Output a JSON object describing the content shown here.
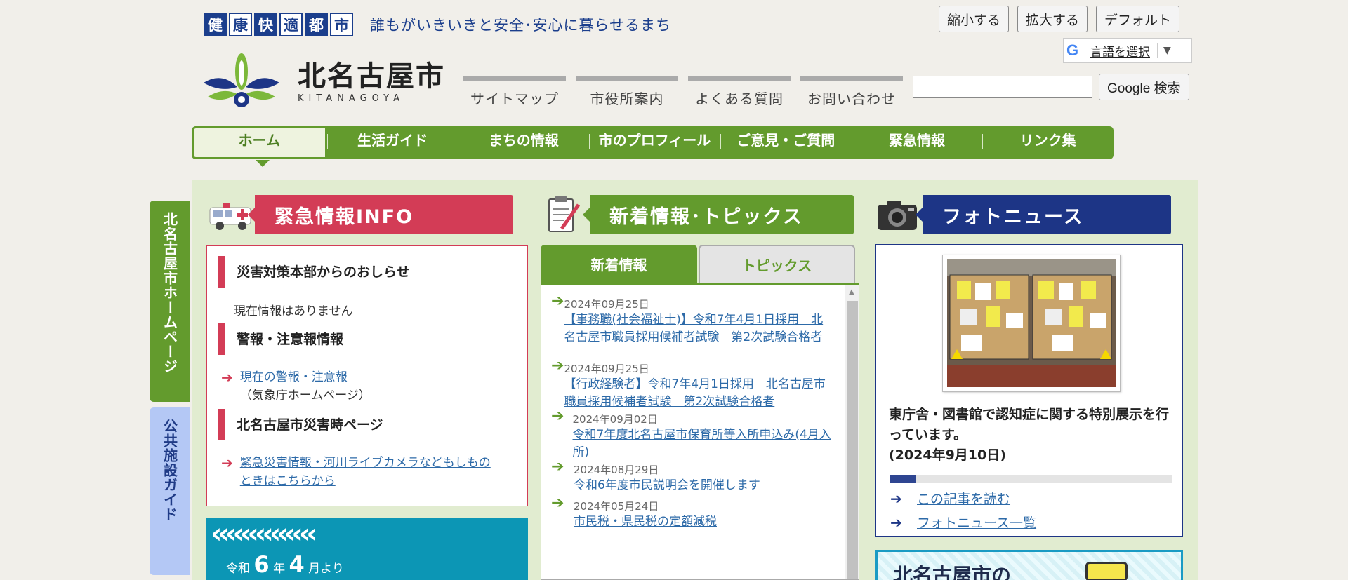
{
  "header": {
    "slogan_kanji": [
      "健",
      "康",
      "快",
      "適",
      "都",
      "市"
    ],
    "tagline": "誰もがいきいきと安全･安心に暮らせるまち",
    "city_name_jp": "北名古屋市",
    "city_name_en": "KITANAGOYA",
    "subnav": [
      "サイトマップ",
      "市役所案内",
      "よくある質問",
      "お問い合わせ"
    ],
    "size_buttons": [
      "縮小する",
      "拡大する",
      "デフォルト"
    ],
    "language": {
      "icon": "G",
      "label": "言語を選択",
      "arrow": "▼"
    },
    "search": {
      "placeholder": "",
      "button": "Google 検索"
    }
  },
  "main_nav": [
    "ホーム",
    "生活ガイド",
    "まちの情報",
    "市のプロフィール",
    "ご意見・ご質問",
    "緊急情報",
    "リンク集"
  ],
  "side_tabs": {
    "home": "北名古屋市ホームページ",
    "facility": "公共施設ガイド"
  },
  "emergency": {
    "title": "緊急情報INFO",
    "h1": "災害対策本部からのおしらせ",
    "no_info": "現在情報はありません",
    "h2": "警報・注意報情報",
    "link1": "現在の警報・注意報",
    "link1_note": "（気象庁ホームページ）",
    "h3": "北名古屋市災害時ページ",
    "link2": "緊急災害情報・河川ライブカメラなどもしものときはこちらから"
  },
  "banner": {
    "chevrons": "‹‹‹‹‹‹‹‹‹‹‹‹‹‹",
    "prefix": "令和",
    "n1": "6",
    "year": "年",
    "n2": "4",
    "month": "月より"
  },
  "news": {
    "title": "新着情報･トピックス",
    "tabs": [
      "新着情報",
      "トピックス"
    ],
    "items": [
      {
        "date": "2024年09月25日",
        "text": "【事務職(社会福祉士)】令和7年4月1日採用　北名古屋市職員採用候補者試験　第2次試験合格者"
      },
      {
        "date": "2024年09月25日",
        "text": "【行政経験者】令和7年4月1日採用　北名古屋市職員採用候補者試験　第2次試験合格者"
      },
      {
        "date": "2024年09月02日",
        "text": "令和7年度北名古屋市保育所等入所申込み(4月入所)"
      },
      {
        "date": "2024年08月29日",
        "text": "令和6年度市民説明会を開催します"
      },
      {
        "date": "2024年05月24日",
        "text": "市民税・県民税の定額減税"
      }
    ]
  },
  "photo": {
    "title": "フォトニュース",
    "caption": "東庁舎・図書館で認知症に関する特別展示を行っています。",
    "date": "(2024年9月10日)",
    "progress": 0.09,
    "links": [
      "この記事を読む",
      "フォトニュース一覧"
    ],
    "bottom_banner": "北名古屋市の"
  },
  "colors": {
    "green": "#639b2d",
    "red": "#d33c56",
    "navy": "#1d3586",
    "link": "#2d6aa8"
  }
}
